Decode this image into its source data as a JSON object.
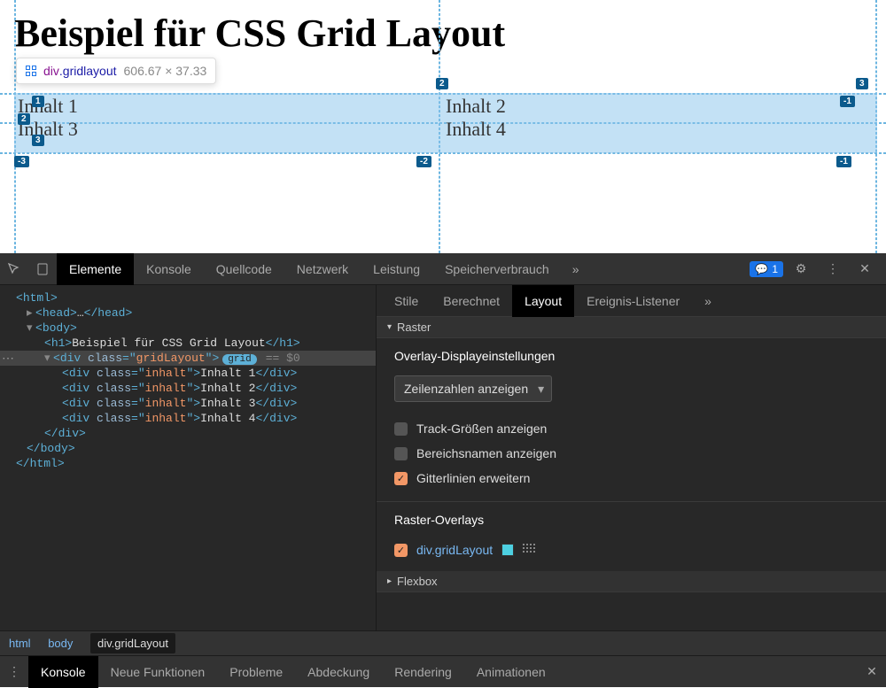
{
  "page": {
    "title": "Beispiel für CSS Grid Layout",
    "grid_cells": [
      "Inhalt 1",
      "Inhalt 2",
      "Inhalt 3",
      "Inhalt 4"
    ]
  },
  "tooltip": {
    "tag": "div",
    "cls": ".gridlayout",
    "dims": "606.67 × 37.33"
  },
  "line_numbers": [
    "1",
    "2",
    "3",
    "-1",
    "2",
    "3",
    "-3",
    "-2",
    "-1"
  ],
  "devtools": {
    "tabs": {
      "elements": "Elemente",
      "console": "Konsole",
      "sources": "Quellcode",
      "network": "Netzwerk",
      "performance": "Leistung",
      "memory": "Speicherverbrauch"
    },
    "issue_count": "1"
  },
  "dom": {
    "html_open": "html",
    "head": "head",
    "body_open": "body",
    "h1_text": "Beispiel für CSS Grid Layout",
    "div_class": "gridLayout",
    "grid_badge": "grid",
    "eq": "== $0",
    "inhalt_class": "inhalt",
    "items": [
      "Inhalt 1",
      "Inhalt 2",
      "Inhalt 3",
      "Inhalt 4"
    ]
  },
  "styles": {
    "tabs": {
      "stile": "Stile",
      "berechnet": "Berechnet",
      "layout": "Layout",
      "ereignis": "Ereignis-Listener"
    },
    "section_raster": "Raster",
    "overlay_settings": "Overlay-Displayeinstellungen",
    "select_value": "Zeilenzahlen anzeigen",
    "chk_track": "Track-Größen anzeigen",
    "chk_area": "Bereichsnamen anzeigen",
    "chk_gitter": "Gitterlinien erweitern",
    "section_overlays": "Raster-Overlays",
    "overlay_item": "div.gridLayout",
    "section_flexbox": "Flexbox"
  },
  "breadcrumb": {
    "html": "html",
    "body": "body",
    "div": "div.gridLayout"
  },
  "drawer": {
    "console": "Konsole",
    "newfn": "Neue Funktionen",
    "problems": "Probleme",
    "coverage": "Abdeckung",
    "rendering": "Rendering",
    "animations": "Animationen"
  }
}
